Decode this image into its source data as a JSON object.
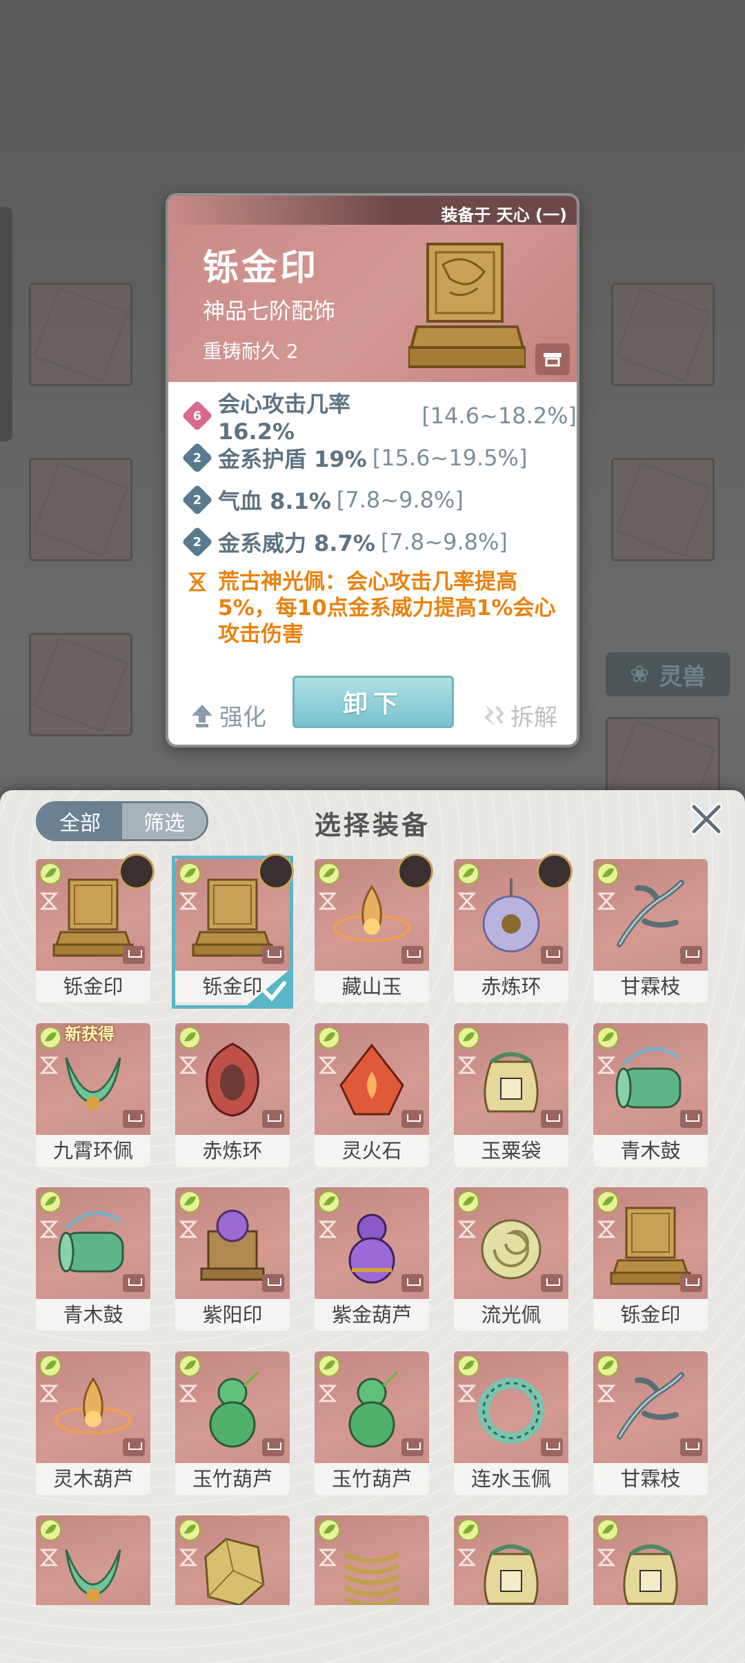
{
  "background": {
    "spirit_beast_label": "灵兽"
  },
  "detail": {
    "equipped_by": "装备于 天心 (一)",
    "name": "铄金印",
    "grade": "神品七阶配饰",
    "reforge": "重铸耐久 2",
    "stats": [
      {
        "badge": "6",
        "badge_color": "#d9698f",
        "name": "会心攻击几率 16.2%",
        "range": "[14.6~18.2%]"
      },
      {
        "badge": "2",
        "badge_color": "#5a7a8e",
        "name": "金系护盾 19%",
        "range": "[15.6~19.5%]"
      },
      {
        "badge": "2",
        "badge_color": "#5a7a8e",
        "name": "气血 8.1%",
        "range": "[7.8~9.8%]"
      },
      {
        "badge": "2",
        "badge_color": "#5a7a8e",
        "name": "金系威力 8.7%",
        "range": "[7.8~9.8%]"
      }
    ],
    "set_bonus": "荒古神光佩：会心攻击几率提高5%，每10点金系威力提高1%会心攻击伤害",
    "actions": {
      "upgrade": "强化",
      "unequip": "卸下",
      "dismantle": "拆解"
    }
  },
  "panel": {
    "title": "选择装备",
    "filter_all": "全部",
    "filter_screen": "筛选",
    "new_tag": "新获得",
    "items": [
      {
        "name": "铄金印",
        "art": "seal-gold",
        "avatar": true,
        "selected": false
      },
      {
        "name": "铄金印",
        "art": "seal-gold",
        "avatar": true,
        "selected": true
      },
      {
        "name": "藏山玉",
        "art": "flame-orb",
        "avatar": true,
        "selected": false
      },
      {
        "name": "赤炼环",
        "art": "purple-pendant",
        "avatar": true,
        "selected": false
      },
      {
        "name": "甘霖枝",
        "art": "branch",
        "avatar": false,
        "selected": false
      },
      {
        "name": "九霄环佩",
        "art": "jade-ring",
        "avatar": false,
        "selected": false,
        "new": true
      },
      {
        "name": "赤炼环",
        "art": "red-ring",
        "avatar": false,
        "selected": false
      },
      {
        "name": "灵火石",
        "art": "fire-stone",
        "avatar": false,
        "selected": false
      },
      {
        "name": "玉粟袋",
        "art": "bag",
        "avatar": false,
        "selected": false
      },
      {
        "name": "青木鼓",
        "art": "drum",
        "avatar": false,
        "selected": false
      },
      {
        "name": "青木鼓",
        "art": "drum",
        "avatar": false,
        "selected": false
      },
      {
        "name": "紫阳印",
        "art": "purple-seal",
        "avatar": false,
        "selected": false
      },
      {
        "name": "紫金葫芦",
        "art": "purple-gourd",
        "avatar": false,
        "selected": false
      },
      {
        "name": "流光佩",
        "art": "disc",
        "avatar": false,
        "selected": false
      },
      {
        "name": "铄金印",
        "art": "seal-gold",
        "avatar": false,
        "selected": false
      },
      {
        "name": "灵木葫芦",
        "art": "flame-orb",
        "avatar": false,
        "selected": false
      },
      {
        "name": "玉竹葫芦",
        "art": "green-gourd",
        "avatar": false,
        "selected": false
      },
      {
        "name": "玉竹葫芦",
        "art": "green-gourd",
        "avatar": false,
        "selected": false
      },
      {
        "name": "连水玉佩",
        "art": "jade-wreath",
        "avatar": false,
        "selected": false
      },
      {
        "name": "甘霖枝",
        "art": "branch",
        "avatar": false,
        "selected": false
      },
      {
        "name": "",
        "art": "jade-ring",
        "avatar": false,
        "selected": false
      },
      {
        "name": "",
        "art": "gold-chunk",
        "avatar": false,
        "selected": false
      },
      {
        "name": "",
        "art": "coil",
        "avatar": false,
        "selected": false
      },
      {
        "name": "",
        "art": "bag",
        "avatar": false,
        "selected": false
      },
      {
        "name": "",
        "art": "bag",
        "avatar": false,
        "selected": false
      }
    ]
  },
  "colors": {
    "accent_teal": "#59b6c6",
    "set_bonus": "#e8820e",
    "stat_text": "#5d7383",
    "card_header": "#d49894"
  }
}
